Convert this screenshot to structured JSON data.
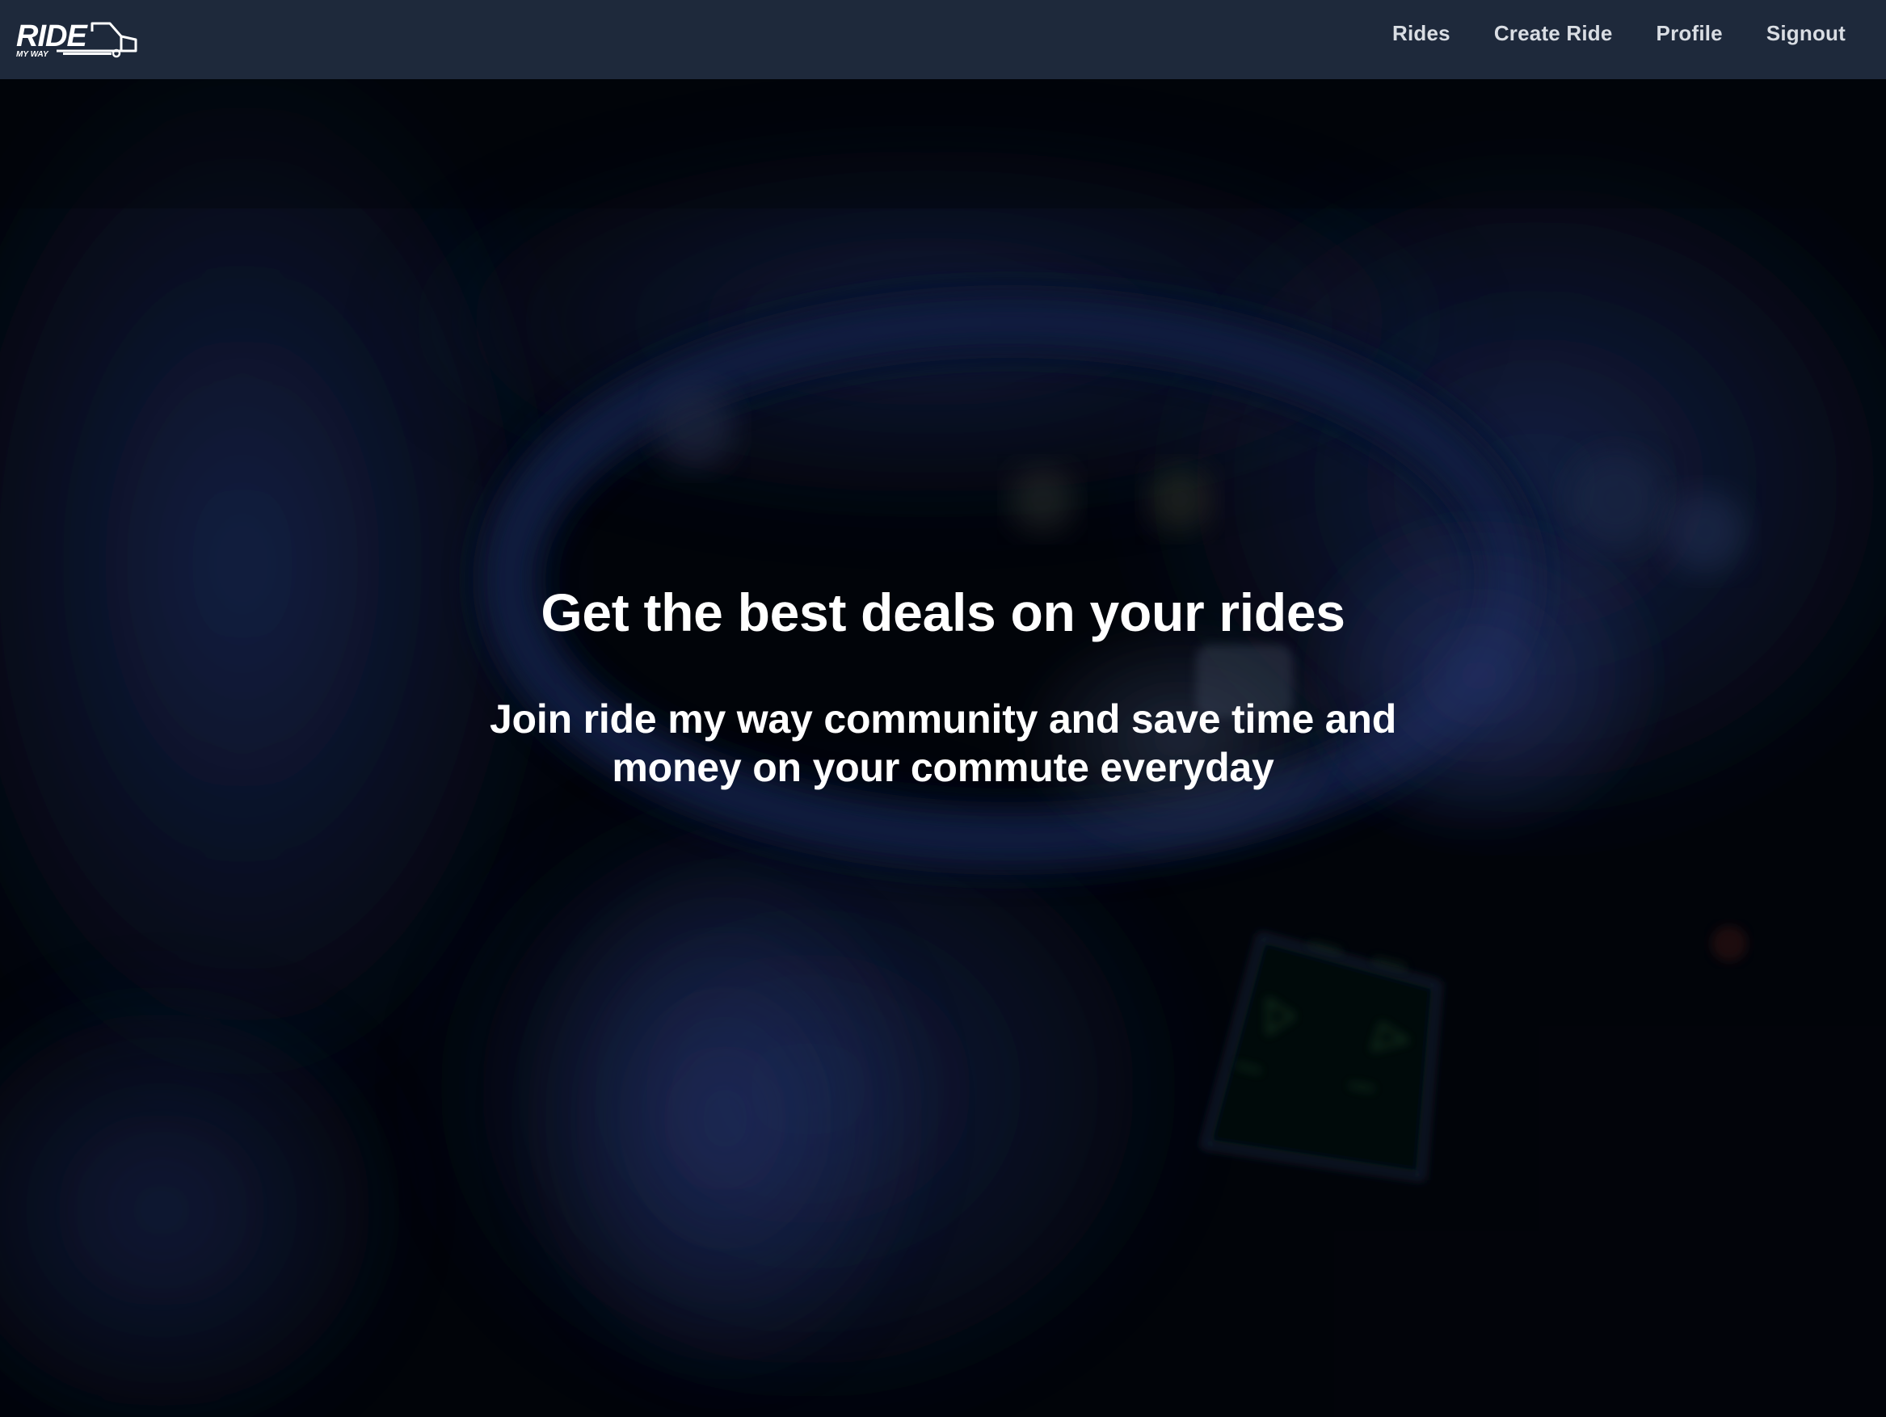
{
  "brand": {
    "logo_text": "RIDE",
    "logo_subtext": "MY WAY"
  },
  "nav": {
    "items": [
      {
        "label": "Rides"
      },
      {
        "label": "Create Ride"
      },
      {
        "label": "Profile"
      },
      {
        "label": "Signout"
      }
    ]
  },
  "hero": {
    "title": "Get the best deals on your rides",
    "subtitle": "Join ride my way community and save time and money on your commute everyday"
  },
  "colors": {
    "navbar_bg": "#1e293b",
    "nav_text": "#d9dde3",
    "hero_text": "#ffffff",
    "hero_bg": "#02050c"
  }
}
